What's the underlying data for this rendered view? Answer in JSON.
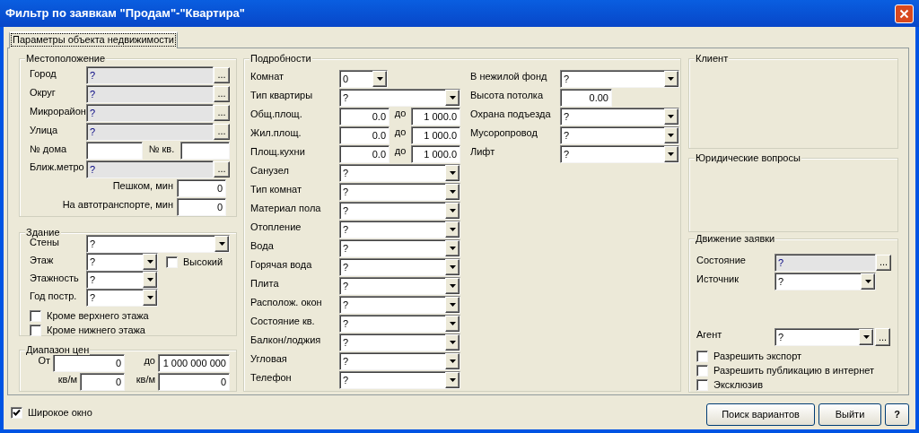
{
  "window": {
    "title": "Фильтр по заявкам \"Продам\"-\"Квартира\""
  },
  "tabs": [
    {
      "label": "Параметры объекта недвижимости",
      "selected": true
    }
  ],
  "location": {
    "title": "Местоположение",
    "rows": [
      {
        "kind": "lookup",
        "label": "Город",
        "value": "?",
        "button": "..."
      },
      {
        "kind": "lookup",
        "label": "Округ",
        "value": "?",
        "button": "..."
      },
      {
        "kind": "lookup",
        "label": "Микрорайон",
        "value": "?",
        "button": "..."
      },
      {
        "kind": "lookup",
        "label": "Улица",
        "value": "?",
        "button": "..."
      },
      {
        "kind": "house",
        "label": "№ дома",
        "label2": "№ кв."
      },
      {
        "kind": "lookup",
        "label": "Ближ.метро",
        "value": "?",
        "button": "..."
      },
      {
        "kind": "minutes",
        "label": "Пешком, мин",
        "value": "0"
      },
      {
        "kind": "minutes",
        "label": "На автотранспорте, мин",
        "value": "0"
      }
    ]
  },
  "building": {
    "title": "Здание",
    "rows": [
      {
        "kind": "combo",
        "label": "Стены",
        "value": "?"
      },
      {
        "kind": "short_combo",
        "label": "Этаж",
        "value": "?",
        "checkbox": {
          "label": "Высокий",
          "checked": false
        }
      },
      {
        "kind": "short_combo",
        "label": "Этажность",
        "value": "?"
      },
      {
        "kind": "short_combo",
        "label": "Год постр.",
        "value": "?"
      }
    ],
    "checkboxes": [
      {
        "label": "Кроме верхнего этажа",
        "checked": false
      },
      {
        "label": "Кроме нижнего этажа",
        "checked": false
      }
    ]
  },
  "price": {
    "title": "Диапазон цен",
    "rows": [
      {
        "label": "От",
        "value": "0",
        "label2": "до",
        "value2": "1 000 000 000"
      },
      {
        "label": "кв/м",
        "value": "0",
        "label2": "кв/м",
        "value2": "0"
      }
    ]
  },
  "details": {
    "title": "Подробности",
    "left": [
      {
        "kind": "short_combo",
        "label": "Комнат",
        "value": "0"
      },
      {
        "kind": "combo",
        "label": "Тип квартиры",
        "value": "?"
      },
      {
        "kind": "range",
        "label": "Общ.площ.",
        "from": "0.0",
        "to_label": "до",
        "to": "1 000.0"
      },
      {
        "kind": "range",
        "label": "Жил.площ.",
        "from": "0.0",
        "to_label": "до",
        "to": "1 000.0"
      },
      {
        "kind": "range",
        "label": "Площ.кухни",
        "from": "0.0",
        "to_label": "до",
        "to": "1 000.0"
      },
      {
        "kind": "combo",
        "label": "Санузел",
        "value": "?"
      },
      {
        "kind": "combo",
        "label": "Тип комнат",
        "value": "?"
      },
      {
        "kind": "combo",
        "label": "Материал пола",
        "value": "?"
      },
      {
        "kind": "combo",
        "label": "Отопление",
        "value": "?"
      },
      {
        "kind": "combo",
        "label": "Вода",
        "value": "?"
      },
      {
        "kind": "combo",
        "label": "Горячая вода",
        "value": "?"
      },
      {
        "kind": "combo",
        "label": "Плита",
        "value": "?"
      },
      {
        "kind": "combo",
        "label": "Располож. окон",
        "value": "?"
      },
      {
        "kind": "combo",
        "label": "Состояние кв.",
        "value": "?"
      },
      {
        "kind": "combo",
        "label": "Балкон/лоджия",
        "value": "?"
      },
      {
        "kind": "combo",
        "label": "Угловая",
        "value": "?"
      },
      {
        "kind": "combo",
        "label": "Телефон",
        "value": "?"
      }
    ],
    "right": [
      {
        "kind": "combo",
        "label": "В нежилой фонд",
        "value": "?"
      },
      {
        "kind": "number",
        "label": "Высота потолка",
        "value": "0.00"
      },
      {
        "kind": "combo",
        "label": "Охрана подъезда",
        "value": "?"
      },
      {
        "kind": "combo",
        "label": "Мусоропровод",
        "value": "?"
      },
      {
        "kind": "combo",
        "label": "Лифт",
        "value": "?"
      }
    ]
  },
  "client": {
    "title": "Клиент"
  },
  "legal": {
    "title": "Юридические вопросы"
  },
  "movement": {
    "title": "Движение заявки",
    "rows": [
      {
        "kind": "lookup",
        "label": "Состояние",
        "value": "?",
        "button": "..."
      },
      {
        "kind": "combo",
        "label": "Источник",
        "value": "?"
      },
      {
        "kind": "combo_lookup",
        "label": "Агент",
        "value": "?",
        "button": "..."
      }
    ],
    "checkboxes": [
      {
        "label": "Разрешить экспорт",
        "checked": false
      },
      {
        "label": "Разрешить публикацию в интернет",
        "checked": false
      },
      {
        "label": "Эксклюзив",
        "checked": false
      }
    ]
  },
  "wide_window": {
    "label": "Широкое окно",
    "checked": true
  },
  "buttons": [
    "Поиск вариантов",
    "Выйти",
    "?"
  ]
}
